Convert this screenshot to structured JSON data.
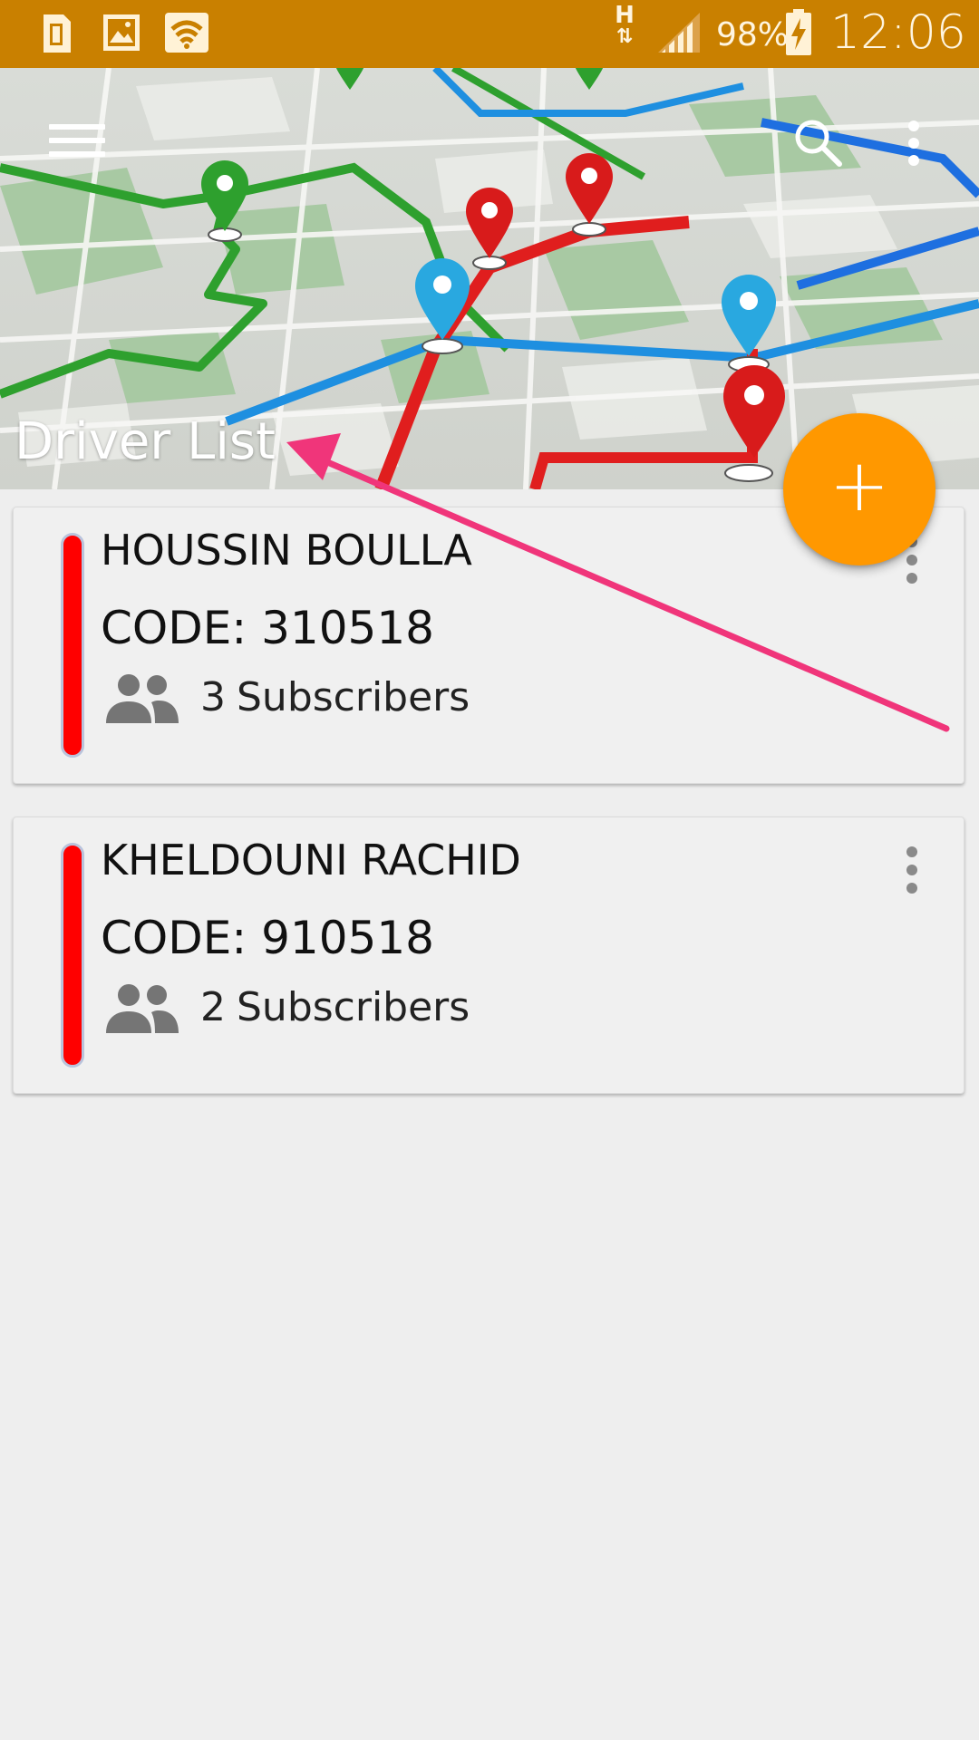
{
  "status_bar": {
    "battery_percent": "98%",
    "time": "12:06",
    "network_type": "H",
    "icons": [
      "sim-card-icon",
      "image-icon",
      "wifi-icon",
      "data-transfer-icon",
      "signal-icon",
      "battery-charging-icon"
    ]
  },
  "header": {
    "title": "Driver List",
    "menu_icon": "hamburger-icon",
    "search_icon": "search-icon",
    "overflow_icon": "more-vertical-icon"
  },
  "fab": {
    "label": "+",
    "icon": "add-icon",
    "color": "#ff9800"
  },
  "drivers": [
    {
      "name": "HOUSSIN BOULLA",
      "code": "CODE: 310518",
      "subscribers_count": "3",
      "subscribers_label": "Subscribers",
      "status_color": "#ff0000"
    },
    {
      "name": "KHELDOUNI RACHID",
      "code": "CODE: 910518",
      "subscribers_count": "2",
      "subscribers_label": "Subscribers",
      "status_color": "#ff0000"
    }
  ],
  "colors": {
    "status_bar": "#c98000",
    "background": "#eeeeee",
    "annotation_arrow": "#f0357a"
  }
}
